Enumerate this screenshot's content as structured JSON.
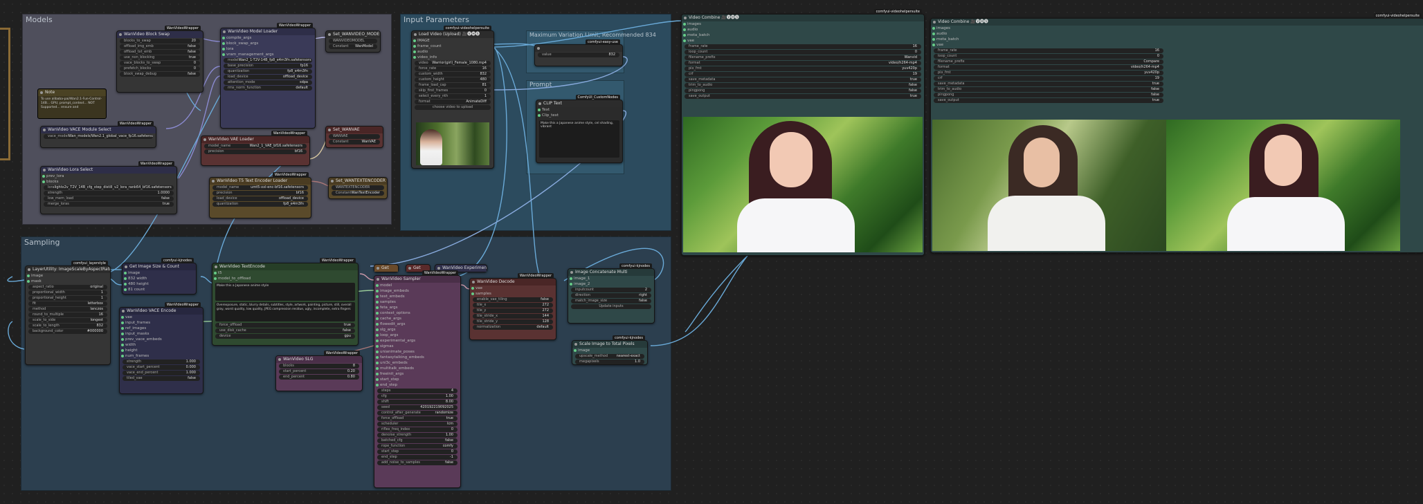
{
  "groups": {
    "models": "Models",
    "input_parameters": "Input Parameters",
    "max_variation": "Maximum Variation Limit, Recommended 834",
    "prompt": "Prompt",
    "sampling": "Sampling"
  },
  "models_group": {
    "block_swap": {
      "title": "WanVideo Block Swap",
      "badge": "WanVideoWrapper",
      "rows": [
        [
          "blocks_to_swap",
          "20"
        ],
        [
          "offload_img_emb",
          "false"
        ],
        [
          "offload_txt_emb",
          "false"
        ],
        [
          "use_non_blocking",
          "true"
        ],
        [
          "vace_blocks_to_swap",
          "0"
        ],
        [
          "prefetch_blocks",
          "0"
        ],
        [
          "block_swap_debug",
          "false"
        ]
      ]
    },
    "model_loader": {
      "title": "WanVideo Model Loader",
      "badge": "WanVideoWrapper",
      "rows": [
        [
          "model",
          "Wan2_1-T2V-14B_fp8_e4m3fn.safetensors"
        ],
        [
          "base_precision",
          "fp16"
        ],
        [
          "quantization",
          "fp8_e4m3fn"
        ],
        [
          "load_device",
          "offload_device"
        ],
        [
          "attention_mode",
          "sdpa"
        ],
        [
          "rms_norm_function",
          "default"
        ]
      ],
      "inputs": [
        "compile_args",
        "block_swap_args",
        "lora",
        "vram_management_args",
        "vace_model",
        "fantasytalking_model",
        "multitalk_model",
        "fantasyportrait_model",
        "extra_model"
      ]
    },
    "set_wanmodel": {
      "title": "Set_WANVIDEO_MODEL",
      "rows": [
        [
          "WANVIDEOMODEL",
          ""
        ],
        [
          "Constant",
          "WanModel"
        ]
      ]
    },
    "note": {
      "title": "Note",
      "text": "To use alibaba-pai/Wan2.1-Fun-Control-14B... GPU, prompt_context... NOT Supported... ensure and"
    },
    "vace_select": {
      "title": "WanVideo VACE Module Select",
      "badge": "WanVideoWrapper",
      "rows": [
        [
          "vace_model",
          "Wan_models/Wan2.1_global_vace_fp16.safetensors"
        ]
      ]
    },
    "lora_select": {
      "title": "WanVideo Lora Select",
      "badge": "WanVideoWrapper",
      "rows": [
        [
          "lora",
          "lightx2v_T2V_14B_cfg_step_distill_v2_lora_rank64_bf16.safetensors"
        ],
        [
          "strength",
          "1.0000"
        ],
        [
          "low_mem_load",
          "false"
        ],
        [
          "merge_loras",
          "true"
        ]
      ],
      "inputs": [
        "prev_lora",
        "blocks"
      ]
    },
    "vae_loader": {
      "title": "WanVideo VAE Loader",
      "badge": "WanVideoWrapper",
      "rows": [
        [
          "model_name",
          "Wan2_1_VAE_bf16.safetensors"
        ],
        [
          "precision",
          "bf16"
        ]
      ]
    },
    "set_vae": {
      "title": "Set_WANVAE",
      "rows": [
        [
          "WANVAE",
          ""
        ],
        [
          "Constant",
          "WanVAE"
        ]
      ]
    },
    "t5_loader": {
      "title": "WanVideo T5 Text Encoder Loader",
      "badge": "WanVideoWrapper",
      "rows": [
        [
          "model_name",
          "umt5-xxl-enc-bf16.safetensors"
        ],
        [
          "precision",
          "bf16"
        ],
        [
          "load_device",
          "offload_device"
        ],
        [
          "quantization",
          "fp8_e4m3fn"
        ]
      ]
    },
    "set_t5": {
      "title": "Set_WANTEXTENCODER",
      "rows": [
        [
          "WANTEXTENCODER",
          ""
        ],
        [
          "Constant",
          "WanTextEncoder"
        ]
      ]
    }
  },
  "input_group": {
    "load_video": {
      "title": "Load Video (Upload) 🎥🅥🅗🅢",
      "badge": "comfyui-videohelpersuite",
      "outputs": [
        "IMAGE",
        "frame_count",
        "audio",
        "video_info"
      ],
      "rows": [
        [
          "video",
          "Warrior(girl)_Female_1080.mp4"
        ],
        [
          "force_rate",
          "16"
        ],
        [
          "custom_width",
          "832"
        ],
        [
          "custom_height",
          "480"
        ],
        [
          "frame_load_cap",
          "81"
        ],
        [
          "skip_first_frames",
          "0"
        ],
        [
          "select_every_nth",
          "1"
        ],
        [
          "format",
          "AnimateDiff"
        ]
      ],
      "button": "choose video to upload"
    },
    "max_size": {
      "title": "",
      "badge": "comfyui-easy-use",
      "rows": [
        [
          "value",
          "832"
        ]
      ],
      "output": "INT"
    },
    "prompt_node": {
      "title": "CLIP Text",
      "badge": "ComfyUI_CustomNodes",
      "outputs": [
        "Text",
        "Clip_text"
      ],
      "text": "Make this a Japanese anime style, cel shading, vibrant"
    }
  },
  "combine_left": {
    "title": "Video Combine 🎥🅥🅗🅢",
    "badge": "comfyui-videohelpersuite",
    "inputs": [
      "images",
      "audio",
      "meta_batch",
      "vae"
    ],
    "output": "Filenames",
    "rows": [
      [
        "frame_rate",
        "16"
      ],
      [
        "loop_count",
        "0"
      ],
      [
        "filename_prefix",
        "Wanvid"
      ],
      [
        "format",
        "video/h264-mp4"
      ],
      [
        "pix_fmt",
        "yuv420p"
      ],
      [
        "crf",
        "19"
      ],
      [
        "save_metadata",
        "true"
      ],
      [
        "trim_to_audio",
        "false"
      ],
      [
        "pingpong",
        "false"
      ],
      [
        "save_output",
        "true"
      ]
    ]
  },
  "combine_right": {
    "title": "Video Combine 🎥🅥🅗🅢",
    "badge": "comfyui-videohelpersuite",
    "inputs": [
      "images",
      "audio",
      "meta_batch",
      "vae"
    ],
    "output": "Filenames",
    "rows": [
      [
        "frame_rate",
        "16"
      ],
      [
        "loop_count",
        "0"
      ],
      [
        "filename_prefix",
        "Compare"
      ],
      [
        "format",
        "video/h264-mp4"
      ],
      [
        "pix_fmt",
        "yuv420p"
      ],
      [
        "crf",
        "19"
      ],
      [
        "save_metadata",
        "true"
      ],
      [
        "trim_to_audio",
        "false"
      ],
      [
        "pingpong",
        "false"
      ],
      [
        "save_output",
        "true"
      ]
    ]
  },
  "sampling_group": {
    "resize": {
      "title": "LayerUtility: ImageScaleByAspectRatio",
      "badge": "comfyui_layerstyle",
      "inputs": [
        "image",
        "mask"
      ],
      "outputs": [
        "image",
        "mask",
        "original_size",
        "width",
        "height"
      ],
      "rows": [
        [
          "aspect_ratio",
          "original"
        ],
        [
          "proportional_width",
          "1"
        ],
        [
          "proportional_height",
          "1"
        ],
        [
          "fit",
          "letterbox"
        ],
        [
          "method",
          "lanczos"
        ],
        [
          "round_to_multiple",
          "16"
        ],
        [
          "scale_to_side",
          "longest"
        ],
        [
          "scale_to_length",
          "832"
        ],
        [
          "background_color",
          "#000000"
        ]
      ]
    },
    "get_size": {
      "title": "Get Image Size & Count",
      "badge": "comfyui-kjnodes",
      "inputs": [
        "image"
      ],
      "outputs": [
        "image",
        "832 width",
        "480 height",
        "81 count"
      ]
    },
    "vace_encode": {
      "title": "WanVideo VACE Encode",
      "badge": "WanVideoWrapper",
      "inputs": [
        "vae",
        "input_frames",
        "ref_images",
        "input_masks",
        "prev_vace_embeds",
        "width",
        "height",
        "num_frames"
      ],
      "rows": [
        [
          "strength",
          "1.000"
        ],
        [
          "vace_start_percent",
          "0.000"
        ],
        [
          "vace_end_percent",
          "1.000"
        ],
        [
          "tiled_vae",
          "false"
        ]
      ],
      "output": "vace_embeds"
    },
    "text_encode": {
      "title": "WanVideo TextEncode",
      "badge": "WanVideoWrapper",
      "inputs": [
        "t5",
        "model_to_offload"
      ],
      "output": "text_embeds",
      "positive": "Make this a Japanese anime style",
      "negative": "Overexposure, static, blurry details, subtitles, style, artwork, painting, picture, still, overall gray, worst quality, low quality, JPEG compression residue, ugly, incomplete, extra fingers",
      "rows": [
        [
          "force_offload",
          "true"
        ],
        [
          "use_disk_cache",
          "false"
        ],
        [
          "device",
          "gpu"
        ]
      ]
    },
    "get_a": {
      "title": "Get",
      "value": "Get"
    },
    "get_b": {
      "title": "Get",
      "value": "Get"
    },
    "sampler": {
      "title": "WanVideo Sampler",
      "badge": "WanVideoWrapper",
      "inputs": [
        "model",
        "image_embeds",
        "text_embeds",
        "samples",
        "feta_args",
        "context_options",
        "cache_args",
        "flowedit_args",
        "slg_args",
        "loop_args",
        "experimental_args",
        "sigmas",
        "unianimate_poses",
        "fantasytalking_embeds",
        "uni3c_embeds",
        "multitalk_embeds",
        "freeinit_args",
        "start_step",
        "end_step"
      ],
      "outputs": [
        "samples",
        "denoised_samples"
      ],
      "rows": [
        [
          "steps",
          "4"
        ],
        [
          "cfg",
          "1.00"
        ],
        [
          "shift",
          "8.00"
        ],
        [
          "seed",
          "420192219092025"
        ],
        [
          "control_after_generate",
          "randomize"
        ],
        [
          "force_offload",
          "true"
        ],
        [
          "scheduler",
          "lcm"
        ],
        [
          "riflex_freq_index",
          "0"
        ],
        [
          "denoise_strength",
          "1.00"
        ],
        [
          "batched_cfg",
          "false"
        ],
        [
          "rope_function",
          "comfy"
        ],
        [
          "start_step",
          "0"
        ],
        [
          "end_step",
          "-1"
        ],
        [
          "add_noise_to_samples",
          "false"
        ]
      ]
    },
    "decode": {
      "title": "WanVideo Decode",
      "badge": "WanVideoWrapper",
      "inputs": [
        "vae",
        "samples"
      ],
      "output": "images",
      "rows": [
        [
          "enable_vae_tiling",
          "false"
        ],
        [
          "tile_x",
          "272"
        ],
        [
          "tile_y",
          "272"
        ],
        [
          "tile_stride_x",
          "144"
        ],
        [
          "tile_stride_y",
          "128"
        ],
        [
          "normalization",
          "default"
        ]
      ]
    },
    "concat": {
      "title": "Image Concatenate Multi",
      "badge": "comfyui-kjnodes",
      "inputs": [
        "image_1",
        "image_2"
      ],
      "output": "images",
      "rows": [
        [
          "inputcount",
          "2"
        ],
        [
          "direction",
          "right"
        ],
        [
          "match_image_size",
          "false"
        ]
      ],
      "button": "Update inputs"
    },
    "scale_size": {
      "title": "Scale Image to Total Pixels",
      "badge": "comfyui-kjnodes",
      "inputs": [
        "image"
      ],
      "output": "IMAGE",
      "rows": [
        [
          "upscale_method",
          "nearest-exact"
        ],
        [
          "megapixels",
          "1.0"
        ]
      ]
    },
    "exp_args": {
      "title": "WanVideo Experimental Args",
      "badge": "WanVideoWrapper"
    },
    "slg": {
      "title": "WanVideo SLG",
      "badge": "WanVideoWrapper",
      "output": "slg_args",
      "rows": [
        [
          "blocks",
          "8"
        ],
        [
          "start_percent",
          "0.20"
        ],
        [
          "end_percent",
          "0.80"
        ]
      ]
    }
  }
}
